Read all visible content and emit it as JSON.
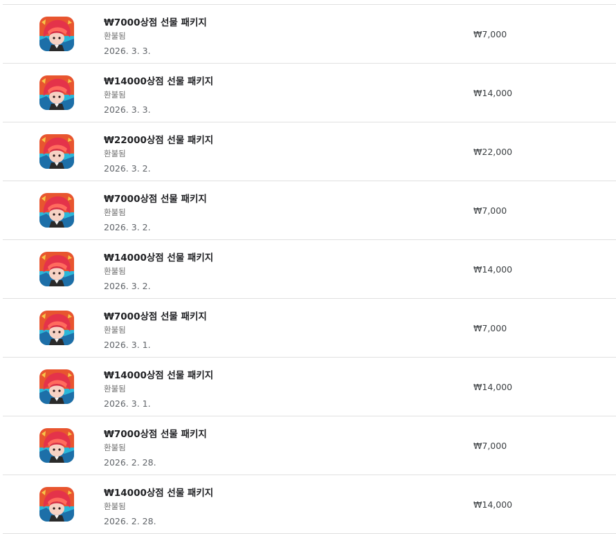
{
  "purchases": [
    {
      "title": "₩7000상점 선물 패키지",
      "status": "환불됨",
      "date": "2026. 3. 3.",
      "price": "₩7,000",
      "icon": "game-character-icon"
    },
    {
      "title": "₩14000상점 선물 패키지",
      "status": "환불됨",
      "date": "2026. 3. 3.",
      "price": "₩14,000",
      "icon": "game-character-icon"
    },
    {
      "title": "₩22000상점 선물 패키지",
      "status": "환불됨",
      "date": "2026. 3. 2.",
      "price": "₩22,000",
      "icon": "game-character-icon"
    },
    {
      "title": "₩7000상점 선물 패키지",
      "status": "환불됨",
      "date": "2026. 3. 2.",
      "price": "₩7,000",
      "icon": "game-character-icon"
    },
    {
      "title": "₩14000상점 선물 패키지",
      "status": "환불됨",
      "date": "2026. 3. 2.",
      "price": "₩14,000",
      "icon": "game-character-icon"
    },
    {
      "title": "₩7000상점 선물 패키지",
      "status": "환불됨",
      "date": "2026. 3. 1.",
      "price": "₩7,000",
      "icon": "game-character-icon"
    },
    {
      "title": "₩14000상점 선물 패키지",
      "status": "환불됨",
      "date": "2026. 3. 1.",
      "price": "₩14,000",
      "icon": "game-character-icon"
    },
    {
      "title": "₩7000상점 선물 패키지",
      "status": "환불됨",
      "date": "2026. 2. 28.",
      "price": "₩7,000",
      "icon": "game-character-icon"
    },
    {
      "title": "₩14000상점 선물 패키지",
      "status": "환불됨",
      "date": "2026. 2. 28.",
      "price": "₩14,000",
      "icon": "game-character-icon"
    }
  ]
}
